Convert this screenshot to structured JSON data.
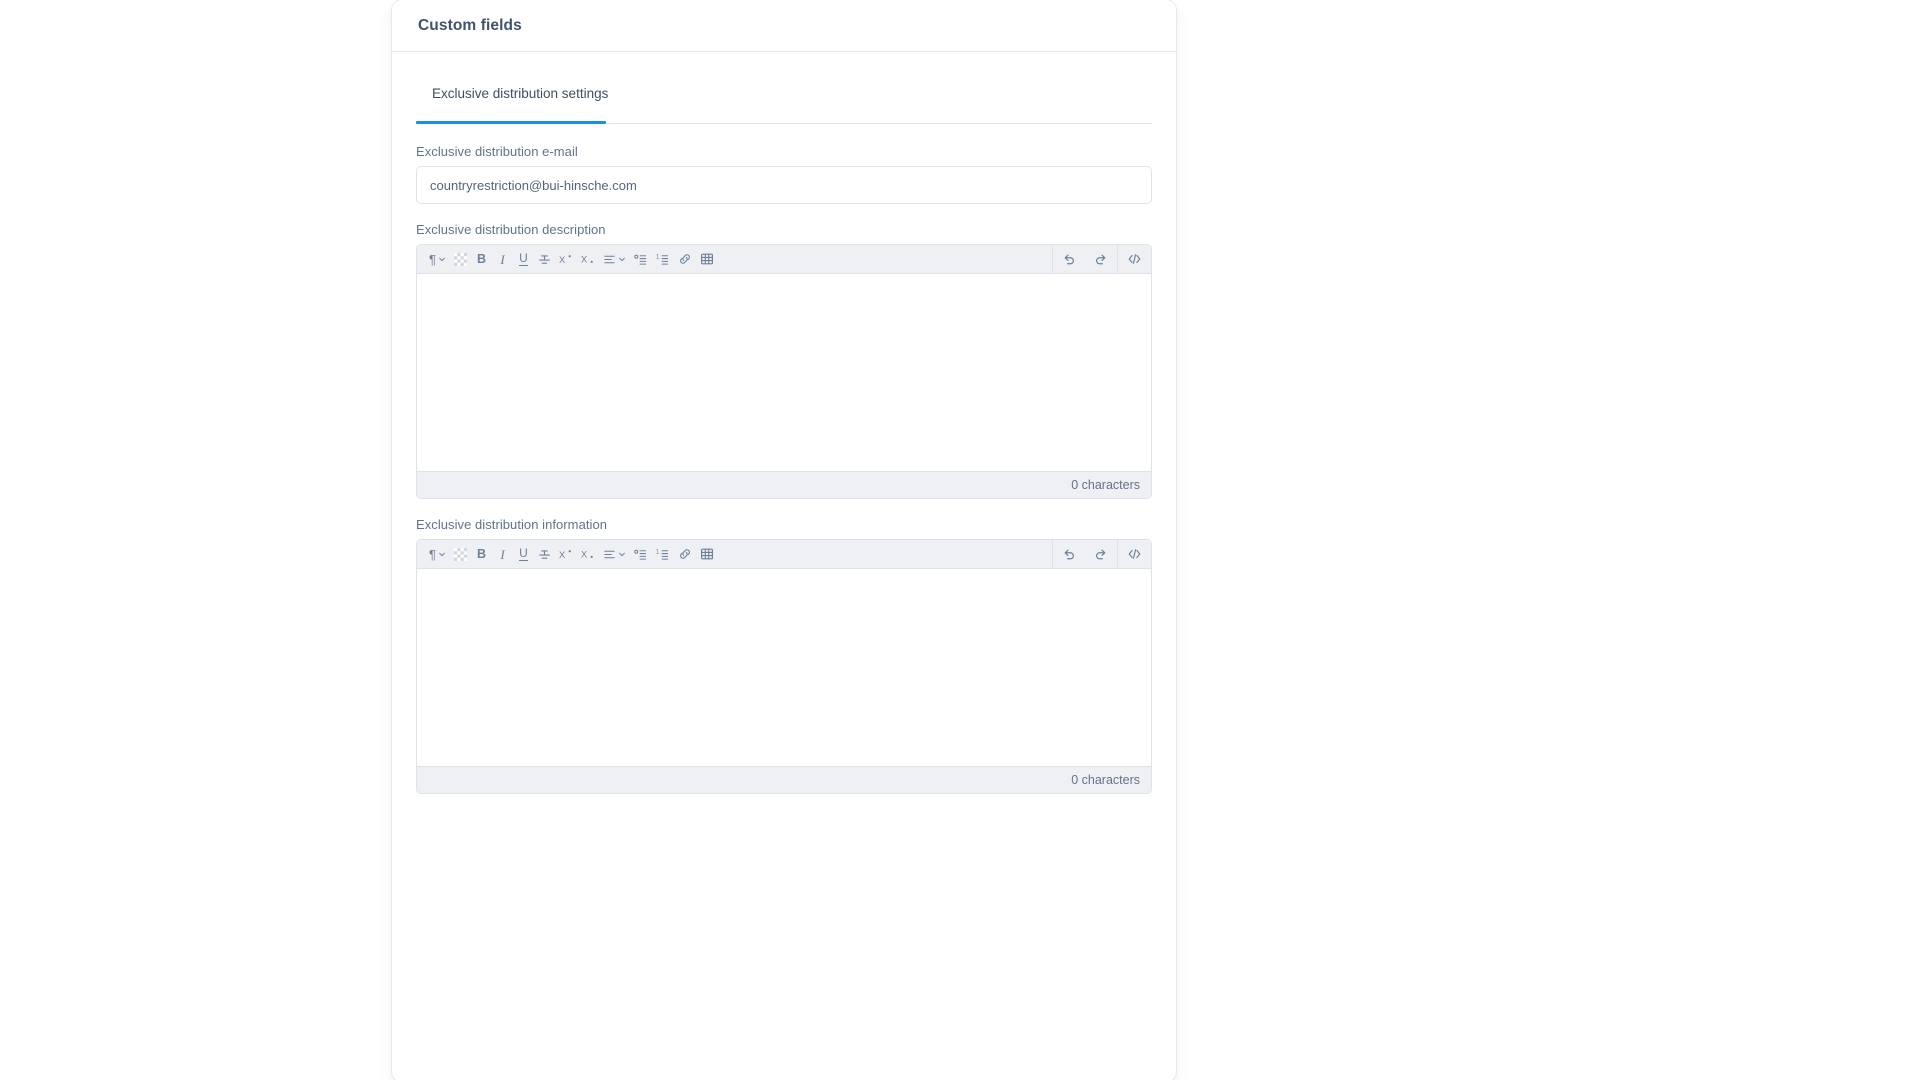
{
  "card": {
    "title": "Custom fields"
  },
  "tabs": [
    {
      "label": "Exclusive distribution settings",
      "active": true
    }
  ],
  "fields": {
    "email": {
      "label": "Exclusive distribution e-mail",
      "value": "countryrestriction@bui-hinsche.com",
      "placeholder": ""
    },
    "description": {
      "label": "Exclusive distribution description",
      "value": "",
      "char_count": "0 characters"
    },
    "information": {
      "label": "Exclusive distribution information",
      "value": "",
      "char_count": "0 characters"
    }
  },
  "toolbar": {
    "left": [
      {
        "name": "paragraph-format",
        "glyph": "¶",
        "has_caret": true
      },
      {
        "name": "text-color-swatch",
        "glyph": "",
        "has_caret": false
      },
      {
        "name": "bold",
        "glyph": "B",
        "has_caret": false
      },
      {
        "name": "italic",
        "glyph": "I",
        "has_caret": false
      },
      {
        "name": "underline",
        "glyph": "U",
        "has_caret": false
      },
      {
        "name": "strikethrough",
        "glyph": "S",
        "has_caret": false
      },
      {
        "name": "superscript",
        "glyph": "X·",
        "has_caret": false
      },
      {
        "name": "subscript",
        "glyph": "X.",
        "has_caret": false
      },
      {
        "name": "align",
        "glyph": "≡",
        "has_caret": true
      },
      {
        "name": "bullet-list",
        "glyph": "",
        "has_caret": false
      },
      {
        "name": "numbered-list",
        "glyph": "",
        "has_caret": false
      },
      {
        "name": "insert-link",
        "glyph": "",
        "has_caret": false
      },
      {
        "name": "insert-table",
        "glyph": "",
        "has_caret": false
      }
    ],
    "right": [
      {
        "name": "undo",
        "glyph": ""
      },
      {
        "name": "redo",
        "glyph": ""
      },
      {
        "name": "source-code",
        "glyph": "</>"
      }
    ]
  },
  "colors": {
    "accent": "#1a90e0",
    "title": "#41536b",
    "label": "#61738c",
    "toolbar_bg": "#eef0f4",
    "border": "#dde3ea"
  }
}
